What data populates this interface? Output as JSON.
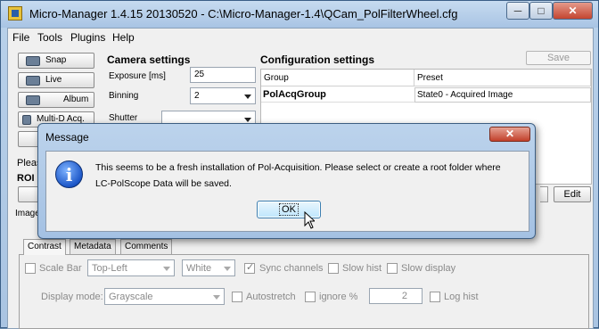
{
  "window": {
    "title": "Micro-Manager 1.4.15  20130520 - C:\\Micro-Manager-1.4\\QCam_PolFilterWheel.cfg",
    "min_glyph": "─",
    "max_glyph": "□",
    "close_glyph": "✕"
  },
  "menu": [
    "File",
    "Tools",
    "Plugins",
    "Help"
  ],
  "toolbar": {
    "snap": "Snap",
    "live": "Live",
    "album": "Album",
    "multid": "Multi-D Acq."
  },
  "left_partial": {
    "please": "Pleas",
    "roi": "ROI",
    "image": "Image"
  },
  "camera": {
    "heading": "Camera settings",
    "exposure_label": "Exposure [ms]",
    "exposure_value": "25",
    "binning_label": "Binning",
    "binning_value": "2",
    "shutter_label": "Shutter",
    "shutter_value": ""
  },
  "config": {
    "heading": "Configuration settings",
    "save_label": "Save",
    "edit_label": "Edit",
    "columns": [
      "Group",
      "Preset"
    ],
    "rows": [
      {
        "group": "PolAcqGroup",
        "preset": "State0 - Acquired Image"
      }
    ]
  },
  "tabs": [
    "Contrast",
    "Metadata",
    "Comments"
  ],
  "contrast": {
    "scale_bar_label": "Scale Bar",
    "position_value": "Top-Left",
    "color_value": "White",
    "sync_channels_label": "Sync channels",
    "slow_hist_label": "Slow hist",
    "slow_display_label": "Slow display",
    "display_mode_label": "Display mode:",
    "display_mode_value": "Grayscale",
    "autostretch_label": "Autostretch",
    "ignore_label": "ignore %",
    "ignore_value": "2",
    "log_hist_label": "Log hist"
  },
  "dialog": {
    "title": "Message",
    "close_glyph": "✕",
    "icon_glyph": "i",
    "line1": "This seems to be a fresh installation of Pol-Acquisition. Please select or create a root folder where",
    "line2": "LC-PolScope Data will be saved.",
    "ok_label": "OK"
  }
}
